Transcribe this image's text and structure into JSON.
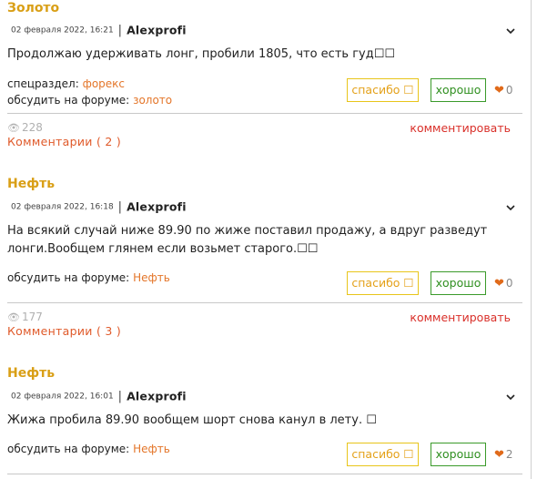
{
  "posts": [
    {
      "title": "Золото",
      "date": "02 февраля 2022, 16:21",
      "author": "Alexprofi",
      "text": "Продолжаю удерживать лонг, пробили 1805, что есть гуд☐☐",
      "subsection_label": "спецраздел:",
      "subsection_value": "форекс",
      "forum_label": "обсудить на форуме:",
      "forum_value": "золото",
      "thanks_label": "спасибо ☐",
      "good_label": "хорошо",
      "likes": "0",
      "views": "228",
      "comments_label": "Комментарии ( 2 )",
      "comment_action": "комментировать"
    },
    {
      "title": "Нефть",
      "date": "02 февраля 2022, 16:18",
      "author": "Alexprofi",
      "text_line1": "На всякий случай ниже 89.90 по жиже поставил продажу, а вдруг разведут",
      "text_line2": "лонги.Вообщем глянем если возьмет старого.☐☐",
      "forum_label": "обсудить на форуме:",
      "forum_value": "Нефть",
      "thanks_label": "спасибо ☐",
      "good_label": "хорошо",
      "likes": "0",
      "views": "177",
      "comments_label": "Комментарии ( 3 )",
      "comment_action": "комментировать"
    },
    {
      "title": "Нефть",
      "date": "02 февраля 2022, 16:01",
      "author": "Alexprofi",
      "text": "Жижа пробила 89.90 вообщем шорт снова канул в лету. ☐",
      "forum_label": "обсудить на форуме:",
      "forum_value": "Нефть",
      "thanks_label": "спасибо ☐",
      "good_label": "хорошо",
      "likes": "2"
    }
  ],
  "colors": {
    "title": "#d99f16",
    "link": "#e4762a",
    "thanks_border": "#e8c51a",
    "good_border": "#3a9a2a",
    "heart": "#e06a1a",
    "comment_action": "#d9302a"
  },
  "icons": {
    "expand": "chevron-down-icon",
    "like": "heart-icon",
    "views": "eye-icon"
  }
}
